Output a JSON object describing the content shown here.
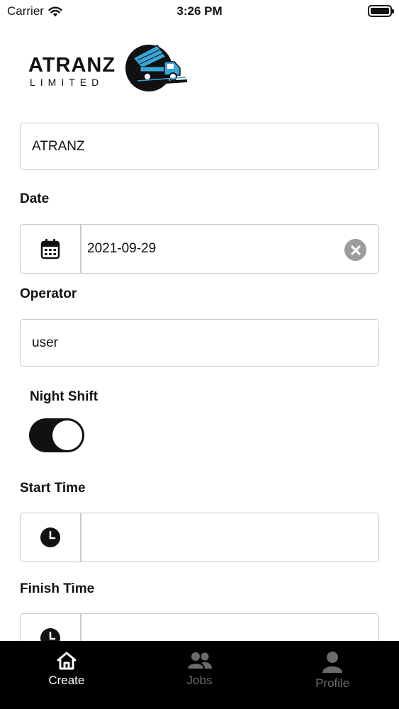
{
  "status_bar": {
    "carrier": "Carrier",
    "time": "3:26 PM"
  },
  "logo": {
    "name": "ATRANZ",
    "subtitle": "LIMITED"
  },
  "form": {
    "company": {
      "value": "ATRANZ"
    },
    "date": {
      "label": "Date",
      "value": "2021-09-29",
      "icon": "calendar-icon"
    },
    "operator": {
      "label": "Operator",
      "value": "user"
    },
    "night_shift": {
      "label": "Night Shift",
      "enabled": true
    },
    "start_time": {
      "label": "Start Time",
      "value": "",
      "icon": "clock-icon"
    },
    "finish_time": {
      "label": "Finish Time",
      "value": "",
      "icon": "clock-icon"
    }
  },
  "tab_bar": {
    "tabs": [
      {
        "label": "Create",
        "icon": "home-icon",
        "active": true
      },
      {
        "label": "Jobs",
        "icon": "people-icon",
        "active": false
      },
      {
        "label": "Profile",
        "icon": "person-icon",
        "active": false
      }
    ]
  },
  "colors": {
    "accent": "#111111",
    "field_border": "#c9c9c9",
    "tab_inactive": "#6b6b6b",
    "logo_blue": "#3aa6d8"
  }
}
